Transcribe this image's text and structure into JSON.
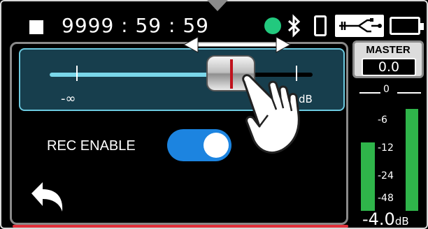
{
  "status": {
    "time": "9999 : 59 : 59",
    "icons": [
      "stop-icon",
      "rec-indicator",
      "bluetooth-icon",
      "phone-icon",
      "usb-power-icon",
      "battery-icon"
    ],
    "colors": {
      "rec_indicator": "#22c97e"
    }
  },
  "fader": {
    "min_label": "-∞",
    "unit_label": "dB",
    "level_fraction": 0.69,
    "colors": {
      "track_fill": "#7ad7ea",
      "card": "#173e4d",
      "knob_line": "#c0121d"
    }
  },
  "rec_enable": {
    "label": "REC ENABLE",
    "state": "on",
    "colors": {
      "toggle_on": "#1c84e0"
    }
  },
  "meter": {
    "master_label": "MASTER",
    "master_value": "0.0",
    "scale": [
      "0",
      "-6",
      "-12",
      "-24",
      "-48"
    ],
    "value": "-4.0",
    "unit": "dB",
    "colors": {
      "bar": "#2fb54a"
    }
  }
}
